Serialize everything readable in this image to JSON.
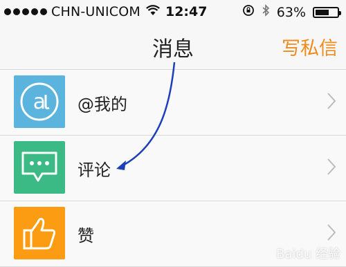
{
  "status_bar": {
    "carrier": "CHN-UNICOM",
    "time": "12:47",
    "battery_percent": "63%",
    "battery_level": 0.63,
    "icons": [
      "signal-dots-icon",
      "wifi-icon",
      "rotation-lock-icon",
      "bluetooth-icon",
      "battery-icon"
    ]
  },
  "nav": {
    "title": "消息",
    "compose_label": "写私信",
    "compose_color": "#f08a1c"
  },
  "list": {
    "items": [
      {
        "label": "@我的",
        "icon": "at-sign-icon",
        "icon_color": "#5ab4de"
      },
      {
        "label": "评论",
        "icon": "comment-bubble-icon",
        "icon_color": "#3cba86"
      },
      {
        "label": "赞",
        "icon": "thumbs-up-icon",
        "icon_color": "#fb9c12"
      }
    ]
  },
  "annotation": {
    "color": "#1b3fb8",
    "type": "curved-arrow"
  },
  "watermark": {
    "text": "Baidu 经验"
  }
}
